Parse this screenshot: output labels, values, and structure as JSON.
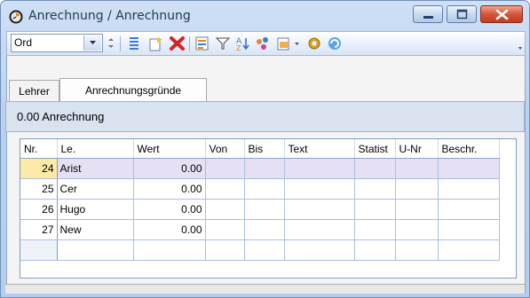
{
  "window": {
    "title": "Anrechnung / Anrechnung",
    "accent": "#1e395b",
    "frame_color": "#b9d1ee"
  },
  "toolbar": {
    "combo_value": "Ord",
    "icons": [
      "dropdown-arrow-icon",
      "spin-icon",
      "list-icon",
      "new-record-icon",
      "delete-icon",
      "report-icon",
      "filter-icon",
      "sort-icon",
      "link-icon",
      "print-icon",
      "settings-icon",
      "refresh-icon"
    ]
  },
  "tabs": [
    {
      "label": "Lehrer",
      "active": false
    },
    {
      "label": "Anrechnungsgründe",
      "active": true
    }
  ],
  "panel": {
    "summary": "0.00 Anrechnung"
  },
  "table": {
    "columns": [
      "Nr.",
      "Le.",
      "Wert",
      "Von",
      "Bis",
      "Text",
      "Statist",
      "U-Nr",
      "Beschr."
    ],
    "rows": [
      {
        "nr": "24",
        "le": "Arist",
        "wert": "0.00"
      },
      {
        "nr": "25",
        "le": "Cer",
        "wert": "0.00"
      },
      {
        "nr": "26",
        "le": "Hugo",
        "wert": "0.00"
      },
      {
        "nr": "27",
        "le": "New",
        "wert": "0.00"
      }
    ]
  }
}
